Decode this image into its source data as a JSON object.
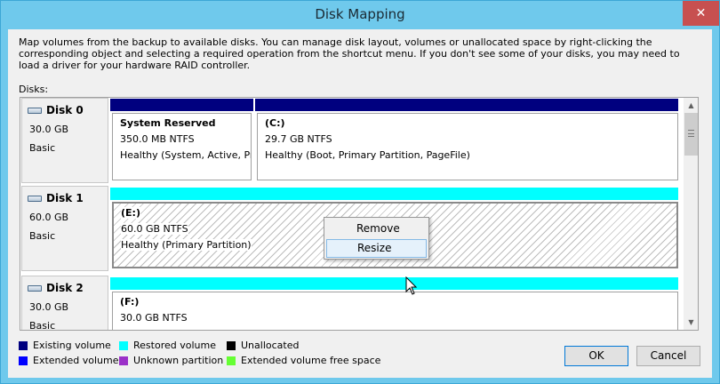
{
  "window": {
    "title": "Disk Mapping",
    "close_label": "✕"
  },
  "description": "Map volumes from the backup to available disks. You can manage disk layout, volumes or unallocated space by right-clicking the corresponding object and selecting a required operation from the shortcut menu. If you don't see some of your disks, you may need to load a driver for your hardware RAID controller.",
  "disks_label": "Disks:",
  "colors": {
    "existing_volume": "#00007f",
    "restored_volume": "#00ffff",
    "unallocated": "#000000",
    "extended_volume": "#0000ff",
    "unknown_partition": "#9b30c8",
    "extended_free_space": "#66ff33"
  },
  "disks": [
    {
      "name": "Disk 0",
      "size": "30.0 GB",
      "type": "Basic",
      "icon": "hard-disk-icon",
      "volumes": [
        {
          "name": "System Reserved",
          "size": "350.0 MB NTFS",
          "status": "Healthy (System, Active, Pri"
        },
        {
          "name": "(C:)",
          "size": "29.7 GB NTFS",
          "status": "Healthy (Boot, Primary Partition, PageFile)"
        }
      ]
    },
    {
      "name": "Disk 1",
      "size": "60.0 GB",
      "type": "Basic",
      "icon": "hard-disk-icon",
      "volumes": [
        {
          "name": "(E:)",
          "size": "60.0 GB NTFS",
          "status": "Healthy (Primary Partition)"
        }
      ]
    },
    {
      "name": "Disk 2",
      "size": "30.0 GB",
      "type": "Basic",
      "icon": "hard-disk-icon",
      "volumes": [
        {
          "name": "(F:)",
          "size": "30.0 GB NTFS",
          "status": ""
        }
      ]
    }
  ],
  "context_menu": {
    "items": [
      "Remove",
      "Resize"
    ],
    "hovered": "Resize"
  },
  "legend": [
    {
      "label": "Existing volume",
      "color": "#00007f"
    },
    {
      "label": "Restored volume",
      "color": "#00ffff"
    },
    {
      "label": "Unallocated",
      "color": "#000000"
    },
    {
      "label": "Extended volume",
      "color": "#0000ff"
    },
    {
      "label": "Unknown partition",
      "color": "#9b30c8"
    },
    {
      "label": "Extended volume free space",
      "color": "#66ff33"
    }
  ],
  "buttons": {
    "ok": "OK",
    "cancel": "Cancel"
  }
}
